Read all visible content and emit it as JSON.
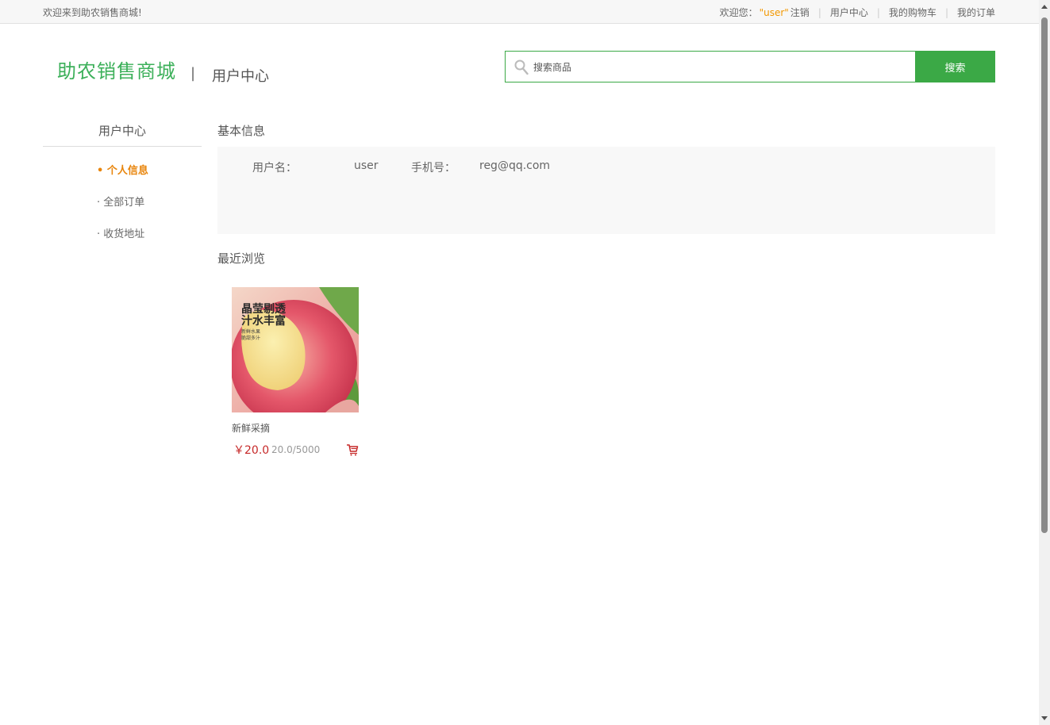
{
  "topbar": {
    "welcome": "欢迎来到助农销售商城!",
    "greeting": "欢迎您：",
    "username": "\"user\"",
    "logout": "注销",
    "user_center": "用户中心",
    "cart": "我的购物车",
    "orders": "我的订单"
  },
  "header": {
    "logo": "助农销售商城",
    "separator": "|",
    "title": "用户中心"
  },
  "search": {
    "placeholder": "搜索商品",
    "button": "搜索"
  },
  "sidebar": {
    "title": "用户中心",
    "items": [
      {
        "label": "• 个人信息",
        "active": true
      },
      {
        "label": "· 全部订单",
        "active": false
      },
      {
        "label": "· 收货地址",
        "active": false
      }
    ]
  },
  "info": {
    "section_title": "基本信息",
    "username_label": "用户名：",
    "username_value": "user",
    "phone_label": "手机号：",
    "phone_value": "reg@qq.com"
  },
  "recent": {
    "section_title": "最近浏览",
    "products": [
      {
        "image_text_line1": "晶莹剔透",
        "image_text_line2": "汁水丰富",
        "image_text_small1": "新鲜水果",
        "image_text_small2": "脆甜多汁",
        "name": "新鲜采摘",
        "price": "￥20.0",
        "stock": "20.0/5000"
      }
    ]
  },
  "colors": {
    "accent_green": "#3ba946",
    "logo_green": "#3cb05a",
    "active_orange": "#e8850c",
    "username_orange": "#f39800",
    "price_red": "#c62828"
  },
  "icons": {
    "search": "search-icon",
    "cart": "cart-icon"
  }
}
